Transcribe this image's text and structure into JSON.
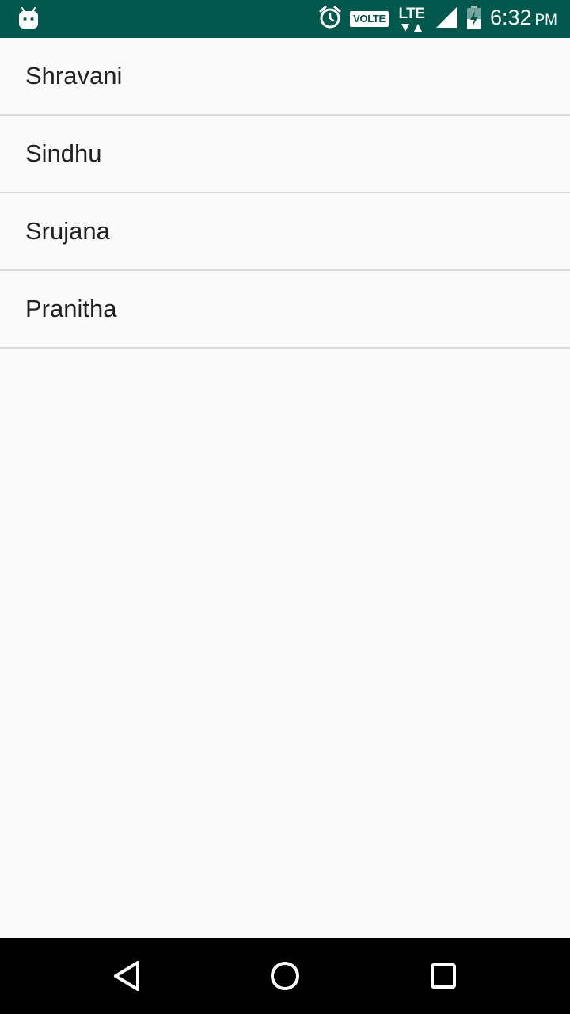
{
  "status_bar": {
    "background": "#00574b",
    "left_icon": "android-robot-icon",
    "icons": [
      "alarm-icon",
      "volte-badge",
      "lte-icon",
      "signal-icon",
      "battery-icon"
    ],
    "volte_label": "VOLTE",
    "network_label": "LTE",
    "time": "6:32",
    "ampm": "PM"
  },
  "list": {
    "items": [
      {
        "label": "Shravani"
      },
      {
        "label": "Sindhu"
      },
      {
        "label": "Srujana"
      },
      {
        "label": "Pranitha"
      }
    ],
    "divider_color": "#dcdcdc"
  },
  "nav_bar": {
    "background": "#000000",
    "buttons": [
      "back-icon",
      "home-icon",
      "recent-apps-icon"
    ]
  }
}
